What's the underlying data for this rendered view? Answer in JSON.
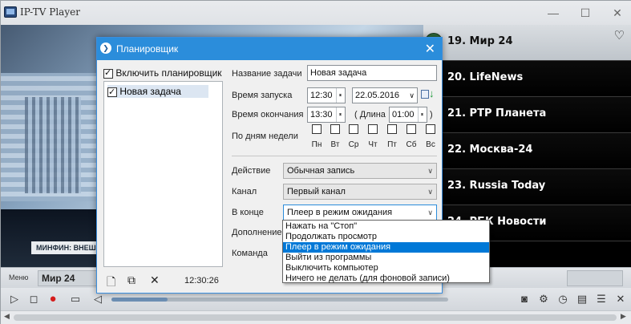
{
  "window": {
    "title": "IP-TV Player",
    "min": "—",
    "max": "☐",
    "close": "✕"
  },
  "video": {
    "ticker": "МИНФИН: ВНЕШ"
  },
  "channels": [
    {
      "label": "19. Мир 24",
      "selected": true
    },
    {
      "label": "20. LifeNews",
      "selected": false
    },
    {
      "label": "21. РТР Планета",
      "selected": false
    },
    {
      "label": "22. Москва-24",
      "selected": false
    },
    {
      "label": "23. Russia Today",
      "selected": false
    },
    {
      "label": "24. РБК Новости",
      "selected": false
    }
  ],
  "menubar": {
    "menu_label": "Меню",
    "current_channel": "Мир 24"
  },
  "dialog": {
    "title": "Планировщик",
    "enable_label": "Включить планировщик",
    "tasks": [
      "Новая задача"
    ],
    "task_name_label": "Название задачи",
    "task_name_value": "Новая задача",
    "start_label": "Время запуска",
    "start_time": "12:30",
    "start_date": "22.05.2016",
    "end_label": "Время окончания",
    "end_time": "13:30",
    "duration_open": "( Длина",
    "duration_value": "01:00",
    "duration_close": ")",
    "dow_label": "По дням недели",
    "days": [
      "Пн",
      "Вт",
      "Ср",
      "Чт",
      "Пт",
      "Сб",
      "Вс"
    ],
    "action_label": "Действие",
    "action_value": "Обычная запись",
    "channel_label": "Канал",
    "channel_value": "Первый канал",
    "end_action_label": "В конце",
    "end_action_value": "Плеер в режим ожидания",
    "extra_label": "Дополнение",
    "command_label": "Команда",
    "clock": "12:30:26"
  },
  "popup_options": [
    "Нажать на \"Стоп\"",
    "Продолжать просмотр",
    "Плеер в режим ожидания",
    "Выйти из программы",
    "Выключить компьютер",
    "Ничего не делать (для фоновой записи)"
  ],
  "popup_selected_index": 2
}
